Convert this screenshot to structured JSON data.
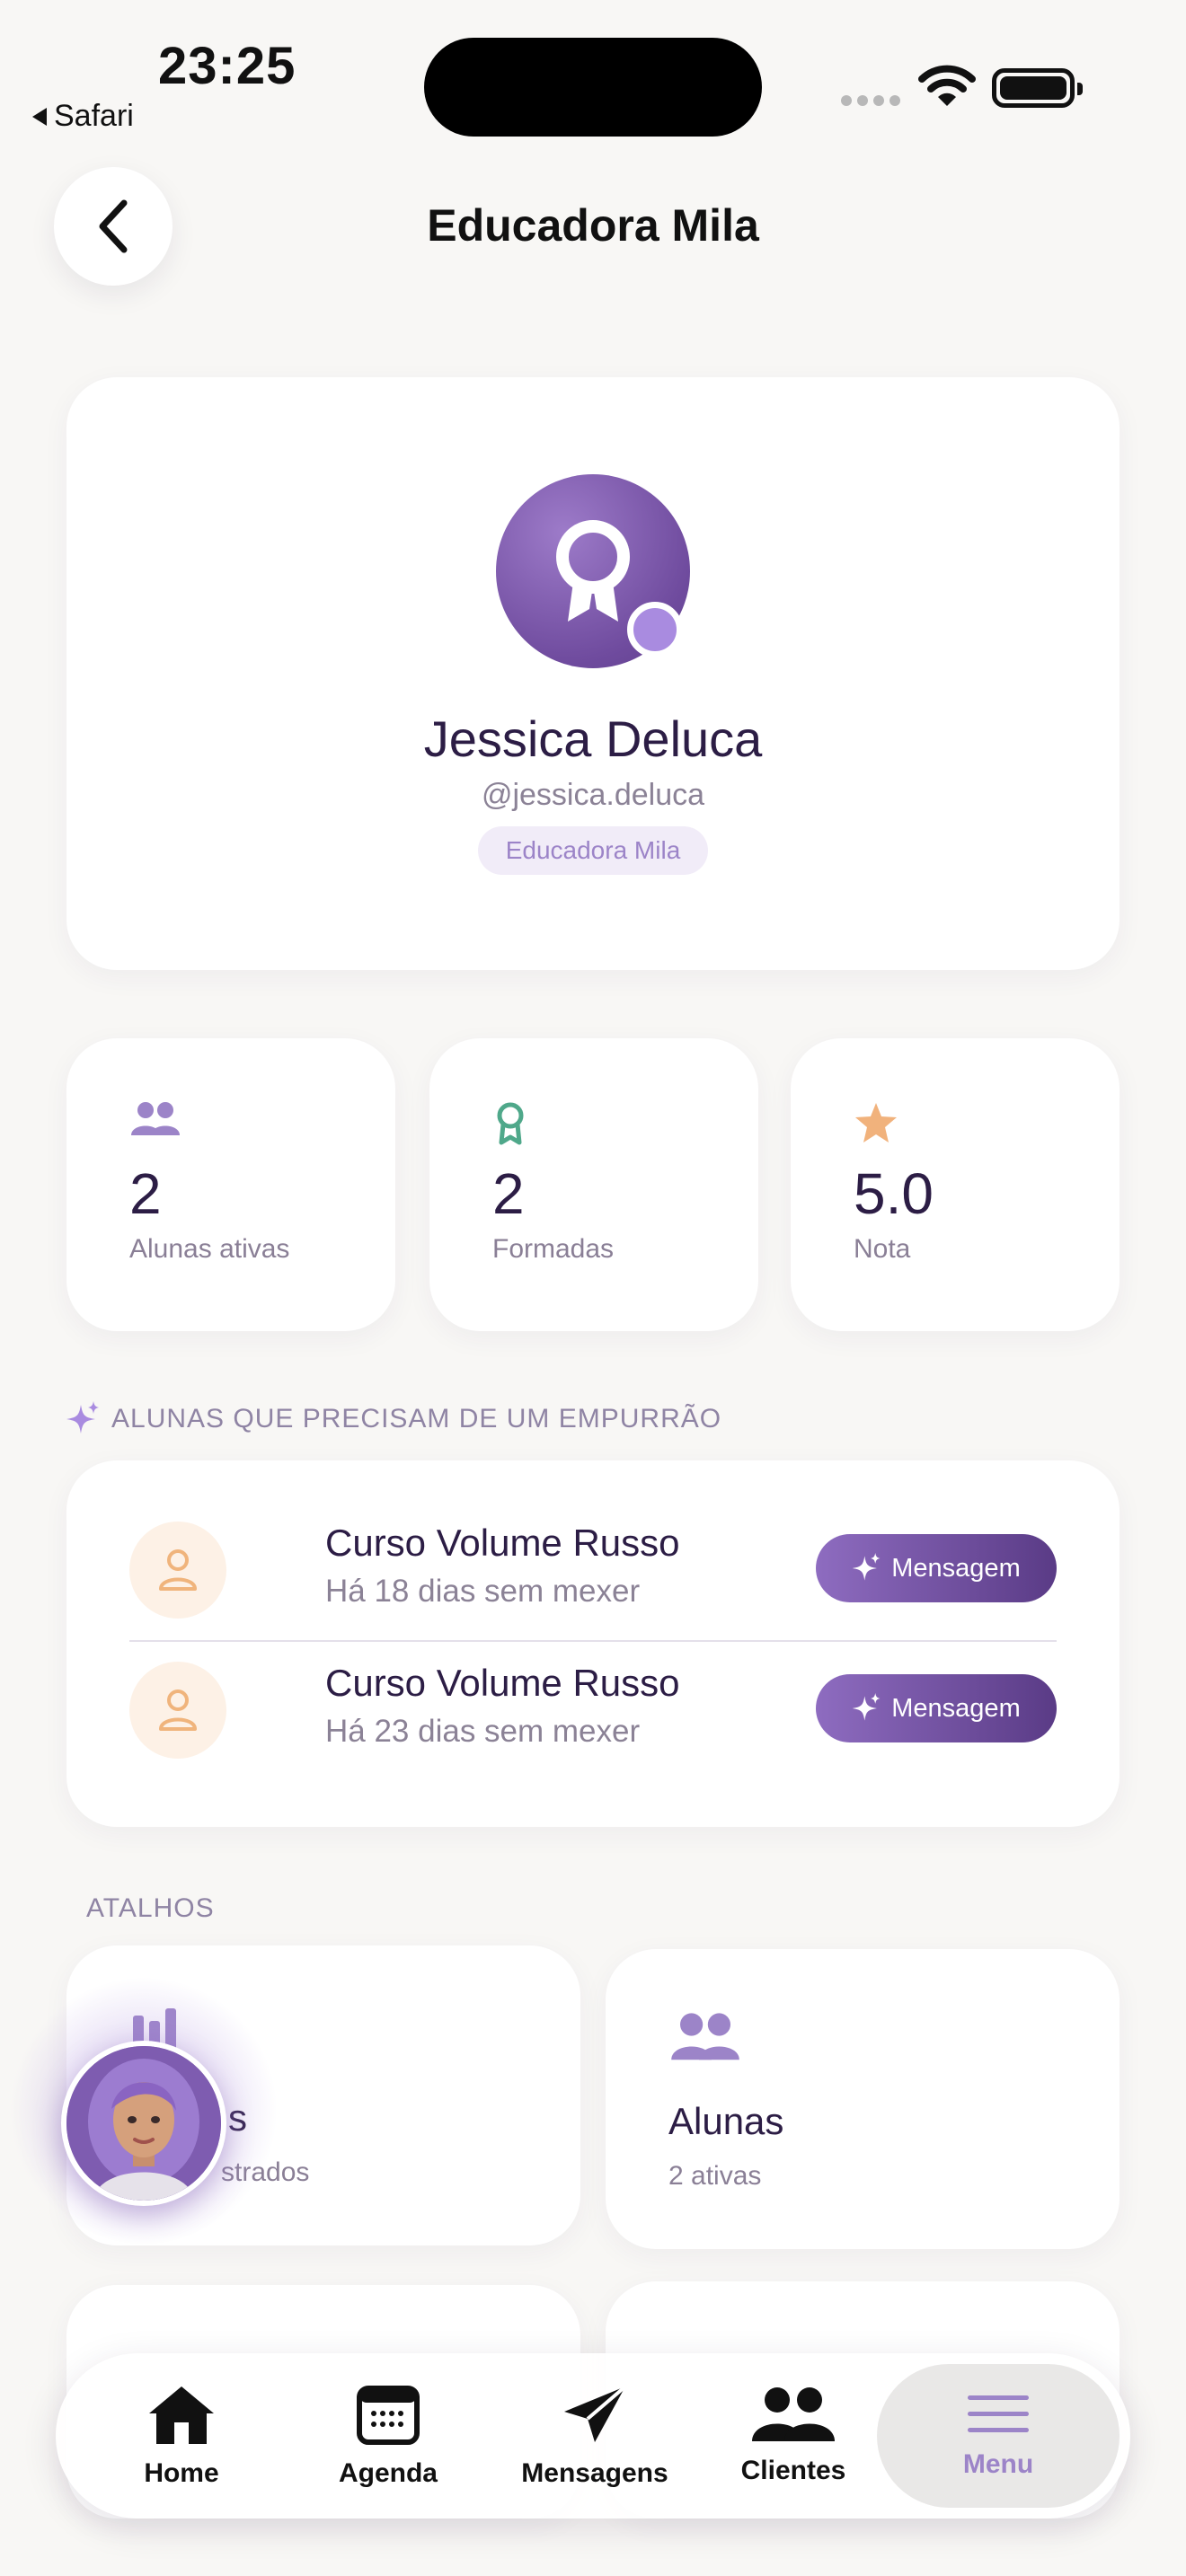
{
  "status_bar": {
    "time": "23:25",
    "back_app": "Safari"
  },
  "header": {
    "title": "Educadora Mila",
    "back_icon": "chevron-left-icon"
  },
  "profile": {
    "name": "Jessica Deluca",
    "handle": "@jessica.deluca",
    "badge": "Educadora Mila",
    "avatar_icon": "award-ribbon-icon",
    "accent": "#6f4b9e"
  },
  "stats": [
    {
      "value": "2",
      "label": "Alunas ativas",
      "icon": "users-icon",
      "color": "#9c84c8"
    },
    {
      "value": "2",
      "label": "Formadas",
      "icon": "award-icon",
      "color": "#4fa88a"
    },
    {
      "value": "5.0",
      "label": "Nota",
      "icon": "star-icon",
      "color": "#f1b27c"
    }
  ],
  "nudge_section": {
    "heading": "ALUNAS QUE PRECISAM DE UM EMPURRÃO",
    "items": [
      {
        "title": "Curso Volume Russo",
        "subtitle": "Há 18 dias sem mexer",
        "button": "Mensagem"
      },
      {
        "title": "Curso Volume Russo",
        "subtitle": "Há 23 dias sem mexer",
        "button": "Mensagem"
      }
    ]
  },
  "shortcuts": {
    "heading": "ATALHOS",
    "items": [
      {
        "title": "s",
        "subtitle": "strados",
        "icon": "chart-bars-icon"
      },
      {
        "title": "Alunas",
        "subtitle": "2 ativas",
        "icon": "users-icon"
      }
    ]
  },
  "bottom_nav": [
    {
      "label": "Home",
      "icon": "home-icon"
    },
    {
      "label": "Agenda",
      "icon": "calendar-icon"
    },
    {
      "label": "Mensagens",
      "icon": "send-icon"
    },
    {
      "label": "Clientes",
      "icon": "users-icon"
    },
    {
      "label": "Menu",
      "icon": "menu-icon",
      "active": true
    }
  ]
}
